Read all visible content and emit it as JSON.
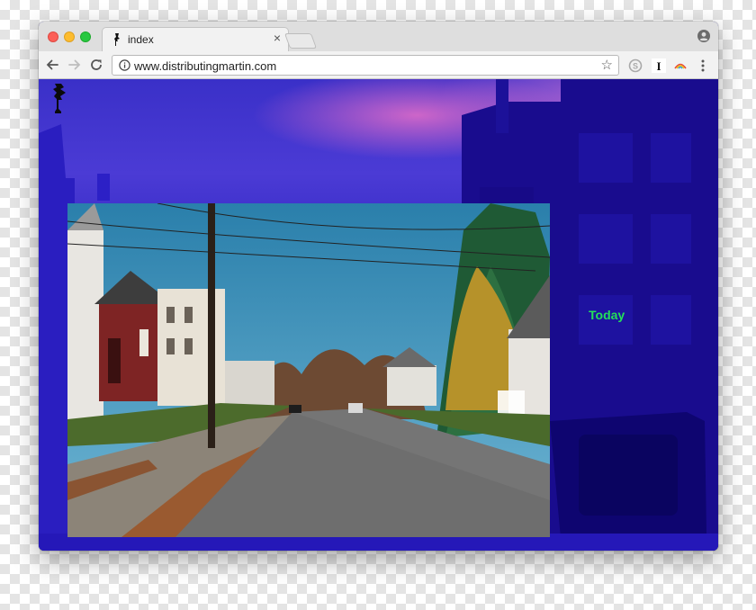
{
  "browser": {
    "tab_title": "index",
    "tab_close_glyph": "×",
    "url": "www.distributingmartin.com",
    "star_glyph": "☆",
    "icons": [
      "back-arrow-icon",
      "forward-arrow-icon",
      "reload-icon",
      "info-icon",
      "star-icon",
      "skype-extension-icon",
      "instapaper-extension-icon",
      "rainbow-extension-icon",
      "menu-dots-icon",
      "profile-icon"
    ]
  },
  "page": {
    "nav_link": "Today",
    "colors": {
      "link": "#23e05a",
      "background_tint": "#1a10a0",
      "sky_pink": "#e06ec8"
    },
    "images": [
      "site-logo-figure",
      "street-photograph"
    ]
  }
}
